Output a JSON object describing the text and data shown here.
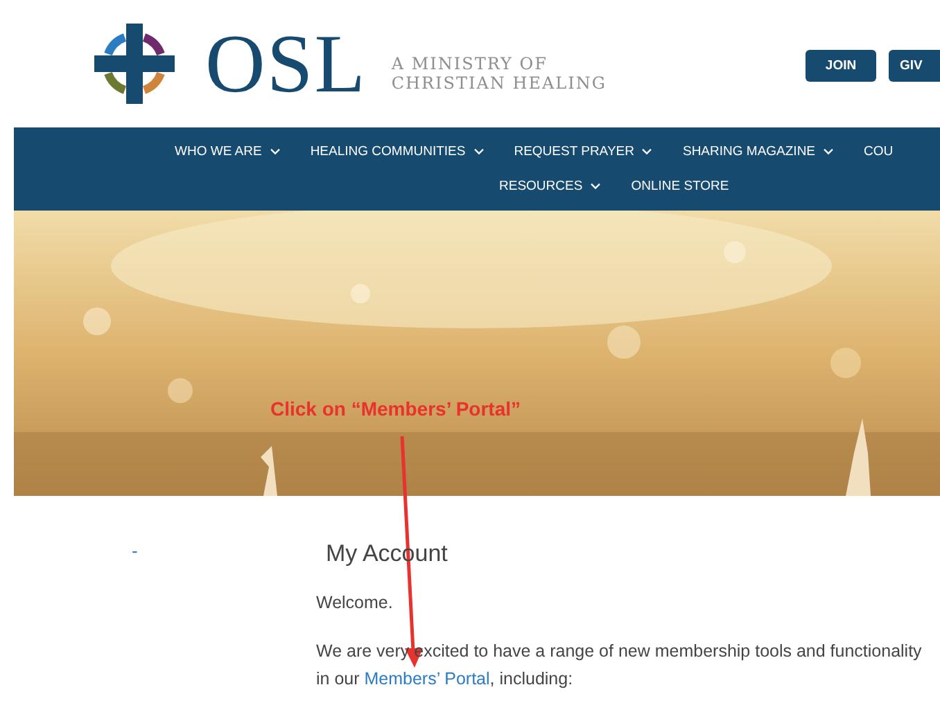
{
  "header": {
    "logo_text": "OSL",
    "tagline": [
      "A MINISTRY OF",
      "CHRISTIAN HEALING"
    ],
    "buttons": [
      "JOIN",
      "GIV"
    ]
  },
  "nav": {
    "primary": [
      {
        "label": "WHO WE ARE",
        "dropdown": true
      },
      {
        "label": "HEALING COMMUNITIES",
        "dropdown": true
      },
      {
        "label": "REQUEST PRAYER",
        "dropdown": true
      },
      {
        "label": "SHARING MAGAZINE",
        "dropdown": true
      },
      {
        "label": "COU",
        "dropdown": false
      }
    ],
    "secondary": [
      {
        "label": "RESOURCES",
        "dropdown": true
      },
      {
        "label": "ONLINE STORE",
        "dropdown": false
      }
    ]
  },
  "hero": {
    "kind": "picture",
    "annotation": "Click on “Members’ Portal”"
  },
  "sidebar": {
    "marker": "-"
  },
  "content": {
    "title": "My Account",
    "welcome": "Welcome.",
    "paragraph": {
      "before": "We are very excited to have a range of new membership tools and functionality in our ",
      "link": "Members’ Portal",
      "after": ", including:"
    }
  }
}
